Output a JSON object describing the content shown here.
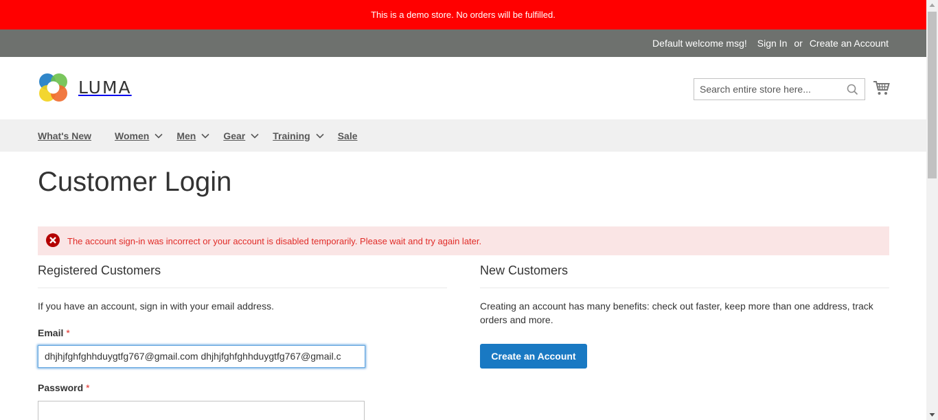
{
  "banner": {
    "text": "This is a demo store. No orders will be fulfilled."
  },
  "topbar": {
    "welcome": "Default welcome msg!",
    "sign_in": "Sign In",
    "or": "or",
    "create_account": "Create an Account"
  },
  "header": {
    "logo_text": "LUMA",
    "search_placeholder": "Search entire store here...",
    "search_icon": "search-icon",
    "cart_icon": "cart-icon"
  },
  "nav": {
    "items": [
      {
        "label": "What's New",
        "has_dropdown": false
      },
      {
        "label": "Women",
        "has_dropdown": true
      },
      {
        "label": "Men",
        "has_dropdown": true
      },
      {
        "label": "Gear",
        "has_dropdown": true
      },
      {
        "label": "Training",
        "has_dropdown": true
      },
      {
        "label": "Sale",
        "has_dropdown": false
      }
    ]
  },
  "page": {
    "title": "Customer Login"
  },
  "error": {
    "text": "The account sign-in was incorrect or your account is disabled temporarily. Please wait and try again later."
  },
  "registered": {
    "title": "Registered Customers",
    "intro": "If you have an account, sign in with your email address.",
    "email_label": "Email",
    "email_value": "dhjhjfghfghhduygtfg767@gmail.com dhjhjfghfghhduygtfg767@gmail.c",
    "password_label": "Password",
    "required_mark": "*"
  },
  "new_customers": {
    "title": "New Customers",
    "text": "Creating an account has many benefits: check out faster, keep more than one address, track orders and more.",
    "button": "Create an Account"
  },
  "colors": {
    "banner_bg": "#ff0000",
    "topbar_bg": "#6e716e",
    "nav_bg": "#f0f0f0",
    "error_bg": "#fae5e5",
    "error_text": "#e02b27",
    "primary_button": "#1979c3"
  }
}
